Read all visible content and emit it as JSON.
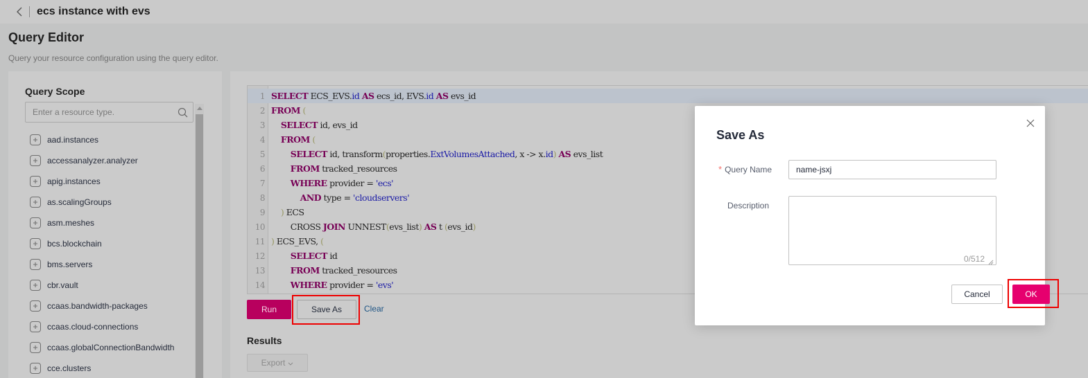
{
  "header": {
    "title": "ecs instance with evs",
    "back_icon": "chevron-left-icon"
  },
  "page": {
    "title": "Query Editor",
    "subtitle": "Query your resource configuration using the query editor."
  },
  "scope": {
    "title": "Query Scope",
    "search_placeholder": "Enter a resource type.",
    "search_icon": "search-icon",
    "items": [
      {
        "label": "aad.instances"
      },
      {
        "label": "accessanalyzer.analyzer"
      },
      {
        "label": "apig.instances"
      },
      {
        "label": "as.scalingGroups"
      },
      {
        "label": "asm.meshes"
      },
      {
        "label": "bcs.blockchain"
      },
      {
        "label": "bms.servers"
      },
      {
        "label": "cbr.vault"
      },
      {
        "label": "ccaas.bandwidth-packages"
      },
      {
        "label": "ccaas.cloud-connections"
      },
      {
        "label": "ccaas.globalConnectionBandwidth"
      },
      {
        "label": "cce.clusters"
      }
    ]
  },
  "editor": {
    "lines": [
      "SELECT ECS_EVS.id AS ecs_id, EVS.id AS evs_id",
      "FROM (",
      "    SELECT id, evs_id",
      "    FROM (",
      "        SELECT id, transform(properties.ExtVolumesAttached, x -> x.id) AS evs_list",
      "        FROM tracked_resources",
      "        WHERE provider = 'ecs'",
      "            AND type = 'cloudservers'",
      "    ) ECS",
      "        CROSS JOIN UNNEST(evs_list) AS t (evs_id)",
      ") ECS_EVS, (",
      "        SELECT id",
      "        FROM tracked_resources",
      "        WHERE provider = 'evs'"
    ],
    "active_line": 1
  },
  "actions": {
    "run": "Run",
    "save_as": "Save As",
    "clear": "Clear"
  },
  "results": {
    "title": "Results",
    "export": "Export"
  },
  "modal": {
    "title": "Save As",
    "close_icon": "close-icon",
    "query_name_label": "Query Name",
    "required_mark": "*",
    "query_name_value": "name-jsxj",
    "description_label": "Description",
    "description_value": "",
    "description_counter": "0/512",
    "cancel": "Cancel",
    "ok": "OK"
  },
  "colors": {
    "primary": "#e6006e",
    "run_button": "#b8005e",
    "highlight_box": "#ee0000",
    "link": "#1f5585"
  }
}
